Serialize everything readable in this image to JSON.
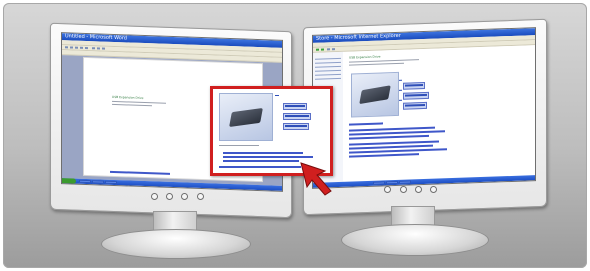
{
  "scene": {
    "description_free": true
  },
  "left_monitor": {
    "window_title": "Untitled - Microsoft Word",
    "doc_heading": "USB Expansion Drive",
    "buttons_count": 4
  },
  "right_monitor": {
    "window_title": "Store - Microsoft Internet Explorer",
    "doc_heading": "USB Expansion Drive",
    "buttons_count": 4
  },
  "dragged_window": {
    "state": "being dragged across monitors"
  },
  "colors": {
    "highlight_border": "#d01f1f",
    "selection": "#3f57c9",
    "heading_green": "#2f7a3e",
    "taskbar_blue": "#1c4ec4"
  },
  "icons": [
    "red-cursor-arrow-icon",
    "monitor-power-button-icon"
  ]
}
